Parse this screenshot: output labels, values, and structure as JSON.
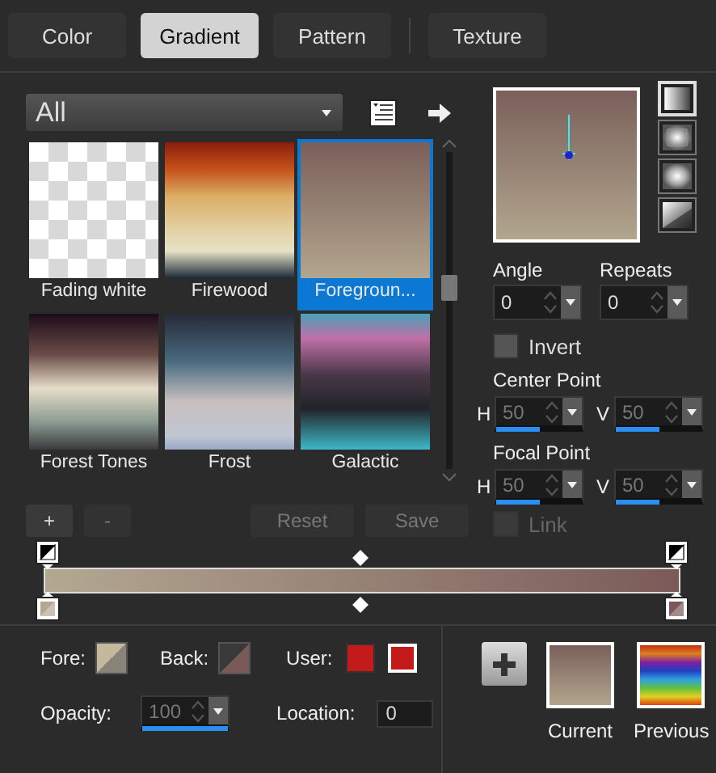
{
  "tabs": [
    {
      "label": "Color",
      "selected": false
    },
    {
      "label": "Gradient",
      "selected": true
    },
    {
      "label": "Pattern",
      "selected": false
    },
    {
      "label": "Texture",
      "selected": false
    }
  ],
  "category": {
    "value": "All"
  },
  "gradients": [
    {
      "name": "Fading white",
      "selected": false
    },
    {
      "name": "Firewood",
      "selected": false
    },
    {
      "name": "Foregroun...",
      "selected": true
    },
    {
      "name": "Forest Tones",
      "selected": false
    },
    {
      "name": "Frost",
      "selected": false
    },
    {
      "name": "Galactic",
      "selected": false
    }
  ],
  "stop_buttons": [
    {
      "label": "+",
      "disabled": false
    },
    {
      "label": "-",
      "disabled": true
    }
  ],
  "actions": [
    {
      "label": "Reset",
      "disabled": true
    },
    {
      "label": "Save",
      "disabled": true
    }
  ],
  "preview_styles": [
    {
      "kind": "linear",
      "selected": true
    },
    {
      "kind": "rectangular",
      "selected": false
    },
    {
      "kind": "sunburst",
      "selected": false
    },
    {
      "kind": "radial",
      "selected": false
    }
  ],
  "angle": {
    "label": "Angle",
    "value": "0",
    "disabled": false
  },
  "repeats": {
    "label": "Repeats",
    "value": "0",
    "disabled": false
  },
  "invert": {
    "label": "Invert",
    "checked": false,
    "disabled": false
  },
  "center_point": {
    "label": "Center Point",
    "h": {
      "label": "H",
      "value": "50",
      "level": 0.5,
      "disabled": true
    },
    "v": {
      "label": "V",
      "value": "50",
      "level": 0.5,
      "disabled": true
    }
  },
  "focal_point": {
    "label": "Focal Point",
    "h": {
      "label": "H",
      "value": "50",
      "level": 0.5,
      "disabled": true
    },
    "v": {
      "label": "V",
      "value": "50",
      "level": 0.5,
      "disabled": true
    }
  },
  "link": {
    "label": "Link",
    "checked": false,
    "disabled": true
  },
  "fore": {
    "label": "Fore:"
  },
  "back": {
    "label": "Back:"
  },
  "user": {
    "label": "User:",
    "swatches": [
      {
        "color": "#c41a1a",
        "selected": false
      },
      {
        "color": "#c41a1a",
        "selected": true
      }
    ]
  },
  "opacity": {
    "label": "Opacity:",
    "value": "100",
    "level": 1,
    "disabled": true
  },
  "location": {
    "label": "Location:",
    "value": "0"
  },
  "current": {
    "label": "Current"
  },
  "previous": {
    "label": "Previous"
  }
}
